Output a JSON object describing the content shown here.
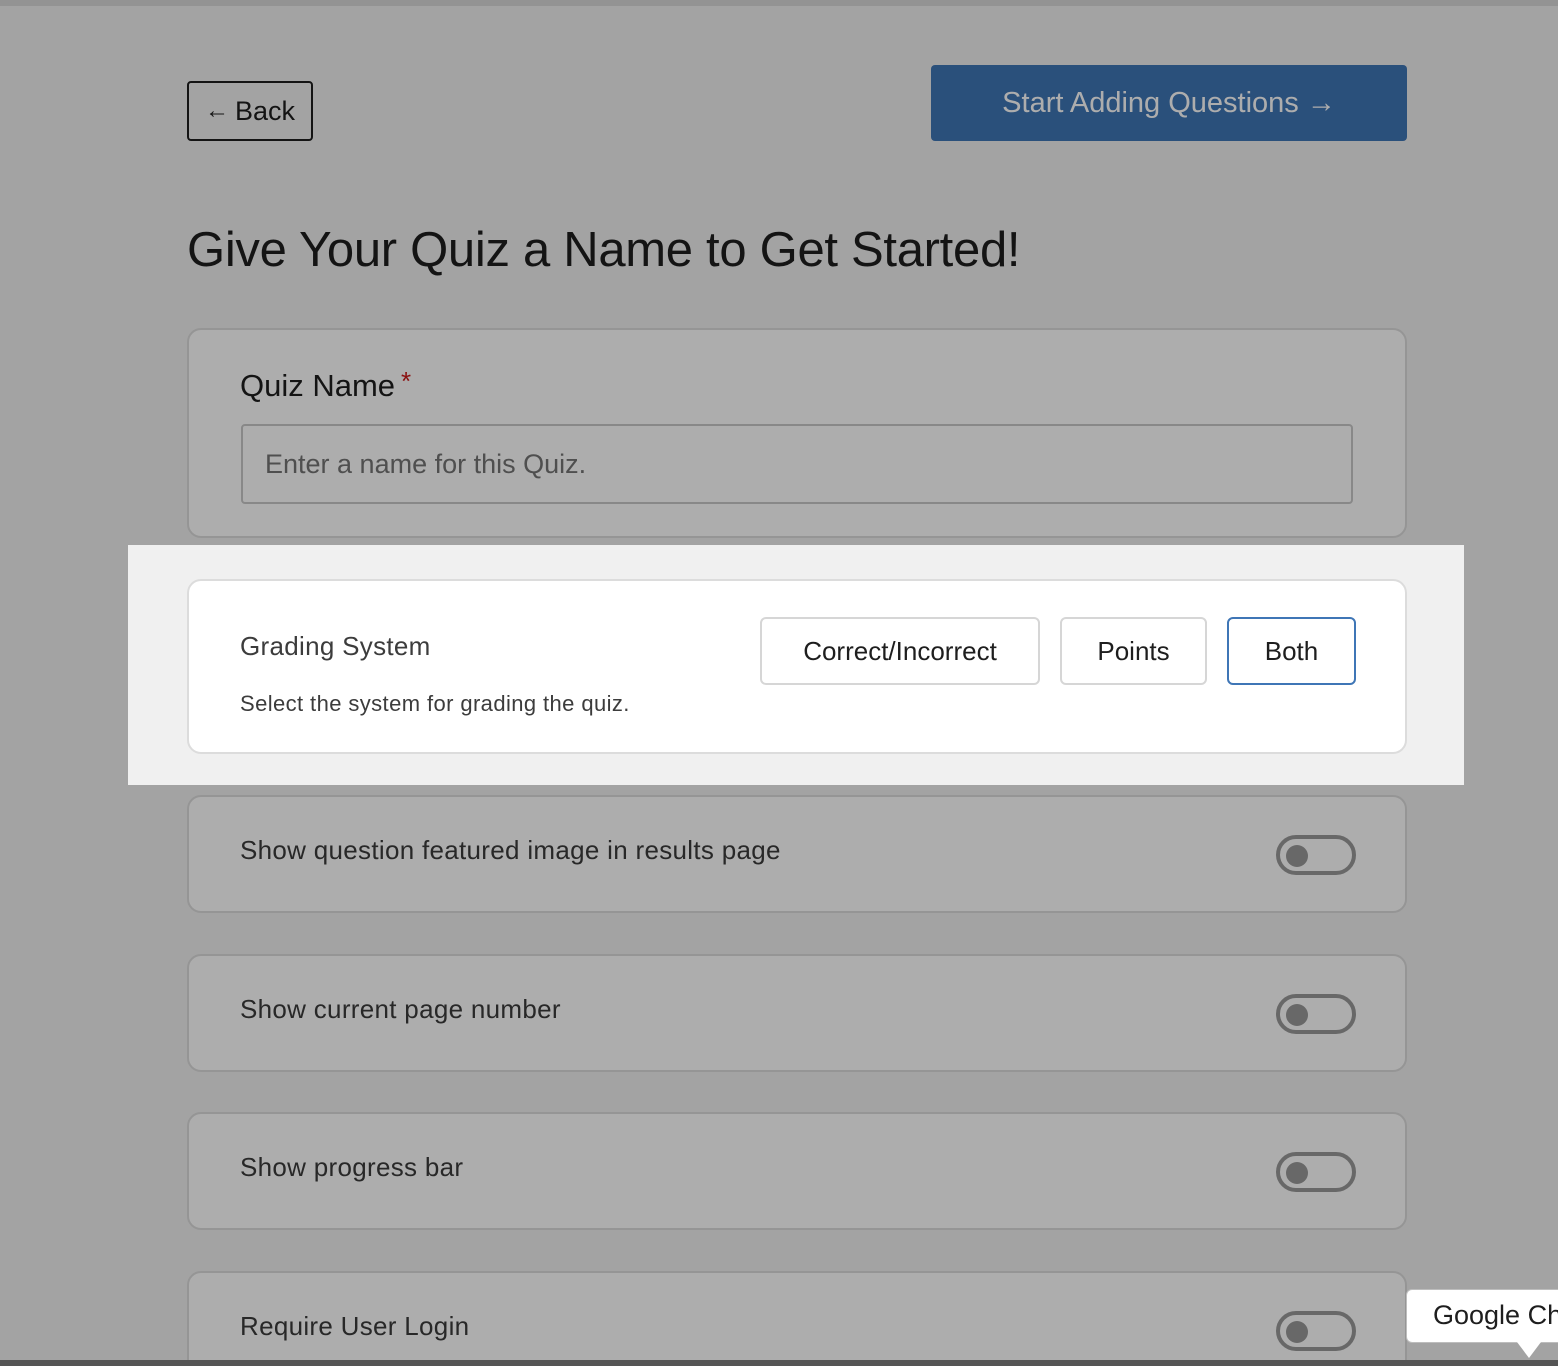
{
  "header": {
    "back_label": "Back",
    "start_label": "Start Adding Questions"
  },
  "page_title": "Give Your Quiz a Name to Get Started!",
  "quiz_name": {
    "label": "Quiz Name",
    "required_mark": "*",
    "placeholder": "Enter a name for this Quiz.",
    "value": ""
  },
  "grading": {
    "title": "Grading System",
    "description": "Select the system for grading the quiz.",
    "options": [
      "Correct/Incorrect",
      "Points",
      "Both"
    ],
    "selected": "Both"
  },
  "toggles": [
    {
      "label": "Show question featured image in results page",
      "on": false
    },
    {
      "label": "Show current page number",
      "on": false
    },
    {
      "label": "Show progress bar",
      "on": false
    },
    {
      "label": "Require User Login",
      "on": false
    }
  ],
  "tooltip": {
    "text": "Google Ch"
  },
  "colors": {
    "primary": "#3f76b6",
    "required": "#cc1818",
    "overlay": "rgba(0,0,0,0.32)"
  },
  "icons": {
    "back": "arrow-left-icon",
    "start": "arrow-right-icon"
  }
}
